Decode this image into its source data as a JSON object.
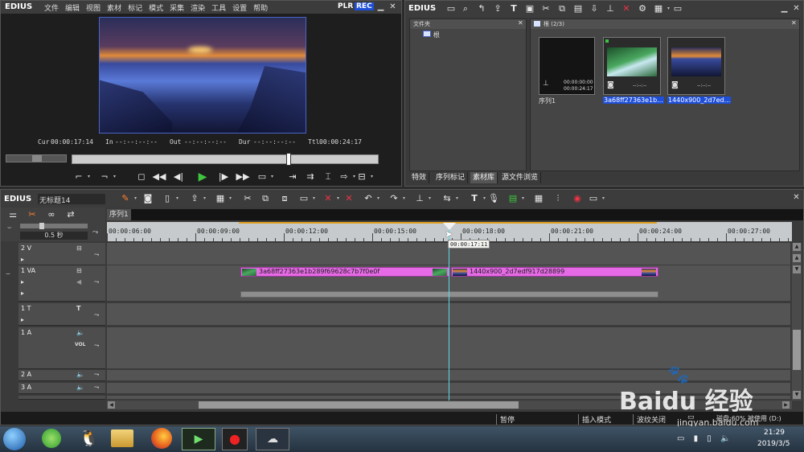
{
  "player": {
    "app_name": "EDIUS",
    "menu": [
      "文件",
      "编辑",
      "视图",
      "素材",
      "标记",
      "模式",
      "采集",
      "渲染",
      "工具",
      "设置",
      "帮助"
    ],
    "plr": "PLR",
    "rec": "REC",
    "cur_label": "Cur",
    "cur_value": "00:00:17:14",
    "in_label": "In",
    "in_value": "--:--:--:--",
    "out_label": "Out",
    "out_value": "--:--:--:--",
    "dur_label": "Dur",
    "dur_value": "--:--:--:--",
    "ttl_label": "Ttl",
    "ttl_value": "00:00:24:17"
  },
  "bin": {
    "app_name": "EDIUS",
    "folder_header": "文件夹",
    "root_folder": "根",
    "root_count": "根 (2/3)",
    "items": [
      {
        "name": "序列1",
        "tc1": "00:00:00:00",
        "tc2": "00:00:24:17",
        "type": "sequence"
      },
      {
        "name": "3a68ff27363e1b...",
        "tc1": "",
        "tc2": "--:--:--",
        "type": "image-green"
      },
      {
        "name": "1440x900_2d7ed...",
        "tc1": "",
        "tc2": "--:--:--",
        "type": "image-blue"
      }
    ],
    "tabs": [
      "特效",
      "序列标记",
      "素材库",
      "源文件浏览"
    ]
  },
  "timeline": {
    "app_name": "EDIUS",
    "project_name": "无标题14",
    "sequence_tab": "序列1",
    "zoom": "0.5 秒",
    "ruler": [
      "00:00:06:00",
      "00:00:09:00",
      "00:00:12:00",
      "00:00:15:00",
      "00:00:18:00",
      "00:00:21:00",
      "00:00:24:00",
      "00:00:27:00"
    ],
    "playhead_tc": "00:00:17:11",
    "tracks": [
      {
        "name": "2 V"
      },
      {
        "name": "1 VA"
      },
      {
        "name": "1 T"
      },
      {
        "name": "1 A"
      },
      {
        "name": "2 A"
      },
      {
        "name": "3 A"
      }
    ],
    "vol_label": "VOL",
    "clips": [
      {
        "name": "3a68ff27363e1b289f69628c7b7f0e0f"
      },
      {
        "name": "1440x900_2d7edf917d28899"
      }
    ]
  },
  "status": {
    "pause": "暂停",
    "insert_mode": "插入模式",
    "ripple_off": "波纹关闭",
    "disk": "磁盘:60% 被使用 (D:)"
  },
  "taskbar": {
    "time": "21:29",
    "date": "2019/3/5"
  },
  "watermark": {
    "text": "Baidu 经验",
    "url": "jingyan.baidu.com"
  },
  "colors": {
    "rec_blue": "#1e4fd8",
    "clip_pink": "#e66ae6",
    "playhead_cyan": "#63d8e6",
    "play_green": "#3ec43e"
  }
}
